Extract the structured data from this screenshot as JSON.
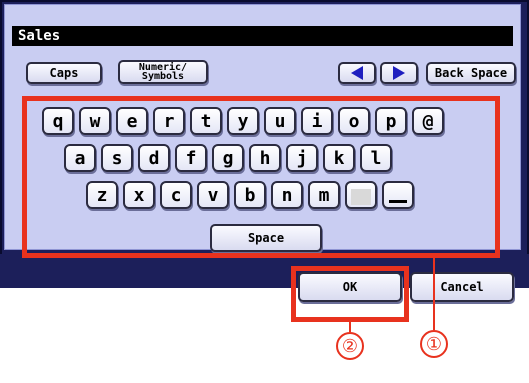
{
  "title_field": {
    "value": "Sales"
  },
  "toolbar": {
    "caps_label": "Caps",
    "numeric_label_line1": "Numeric/",
    "numeric_label_line2": "Symbols",
    "left_arrow_icon": "left-arrow-icon",
    "right_arrow_icon": "right-arrow-icon",
    "backspace_label": "Back Space"
  },
  "keyboard": {
    "row1": [
      "q",
      "w",
      "e",
      "r",
      "t",
      "y",
      "u",
      "i",
      "o",
      "p",
      "@"
    ],
    "row2": [
      "a",
      "s",
      "d",
      "f",
      "g",
      "h",
      "j",
      "k",
      "l"
    ],
    "row3": [
      "z",
      "x",
      "c",
      "v",
      "b",
      "n",
      "m"
    ],
    "dot_key_icon": "dot-key-icon",
    "underscore_key_icon": "underscore-key-icon",
    "space_label": "Space"
  },
  "actions": {
    "ok_label": "OK",
    "cancel_label": "Cancel"
  },
  "callouts": {
    "one": "①",
    "two": "②"
  },
  "colors": {
    "highlight": "#e8321e",
    "panel": "#c9cdf2",
    "frame": "#1c1f5a"
  }
}
